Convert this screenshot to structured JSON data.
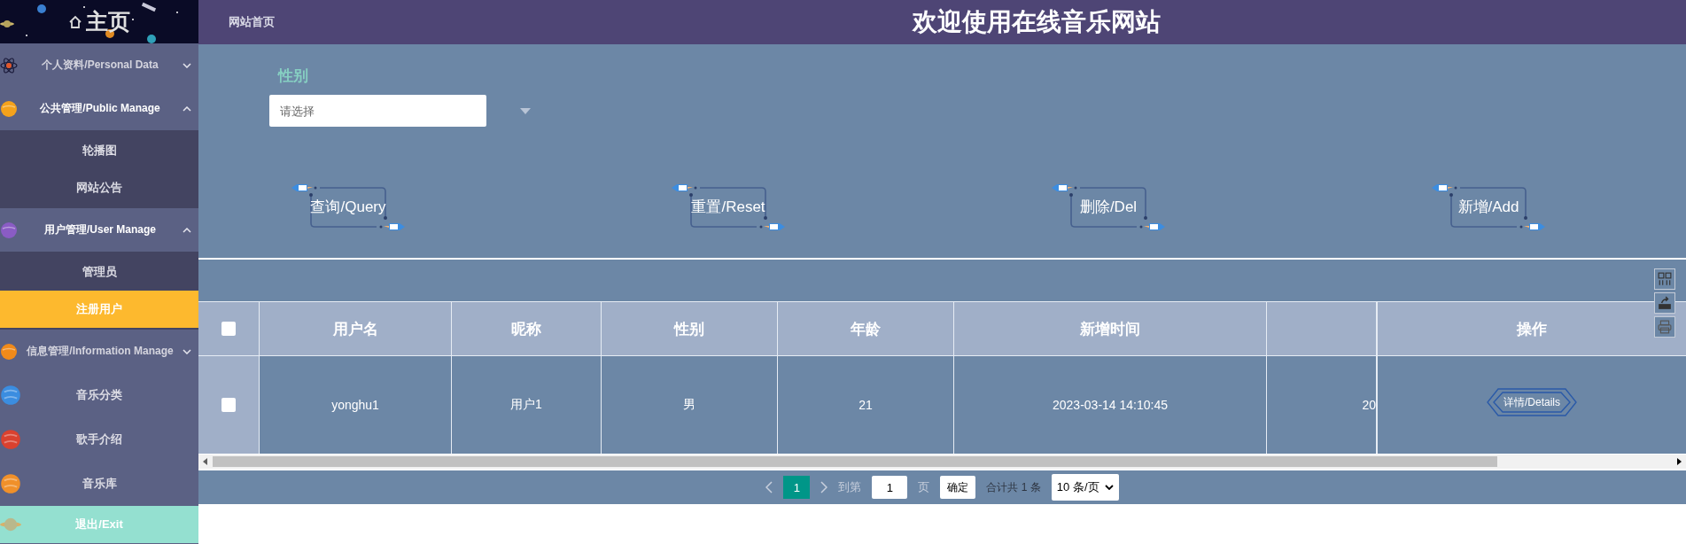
{
  "sidebar": {
    "title": "主页",
    "menu": [
      {
        "kind": "group",
        "label": "个人资料/Personal Data",
        "expanded": false
      },
      {
        "kind": "group",
        "label": "公共管理/Public Manage",
        "expanded": true,
        "children": [
          {
            "label": "轮播图",
            "selected": false
          },
          {
            "label": "网站公告",
            "selected": false
          }
        ]
      },
      {
        "kind": "group",
        "label": "用户管理/User Manage",
        "expanded": true,
        "children": [
          {
            "label": "管理员",
            "selected": false
          },
          {
            "label": "注册用户",
            "selected": true
          }
        ]
      },
      {
        "kind": "group",
        "label": "信息管理/Information Manage",
        "expanded": false
      },
      {
        "kind": "link",
        "label": "音乐分类"
      },
      {
        "kind": "link",
        "label": "歌手介绍"
      },
      {
        "kind": "link",
        "label": "音乐库"
      },
      {
        "kind": "exit",
        "label": "退出/Exit"
      }
    ]
  },
  "header": {
    "breadcrumb": "网站首页",
    "title": "欢迎使用在线音乐网站"
  },
  "filter": {
    "label": "性别",
    "placeholder": "请选择"
  },
  "buttons": [
    "查询/Query",
    "重置/Reset",
    "删除/Del",
    "新增/Add"
  ],
  "table": {
    "header_checked": false,
    "columns": [
      "用户名",
      "昵称",
      "性别",
      "年龄",
      "新增时间"
    ],
    "action_column": "操作",
    "rows": [
      {
        "checked": false,
        "cells": [
          "yonghu1",
          "用户1",
          "男",
          "21",
          "2023-03-14 14:10:45",
          "20"
        ],
        "action": "详情/Details"
      }
    ]
  },
  "pagination": {
    "pages": [
      {
        "label": "1",
        "selected": true
      }
    ],
    "goto_label": "到第",
    "goto_value": "1",
    "page_unit": "页",
    "confirm": "确定",
    "total": "合计共 1 条",
    "page_size": "10 条/页"
  }
}
